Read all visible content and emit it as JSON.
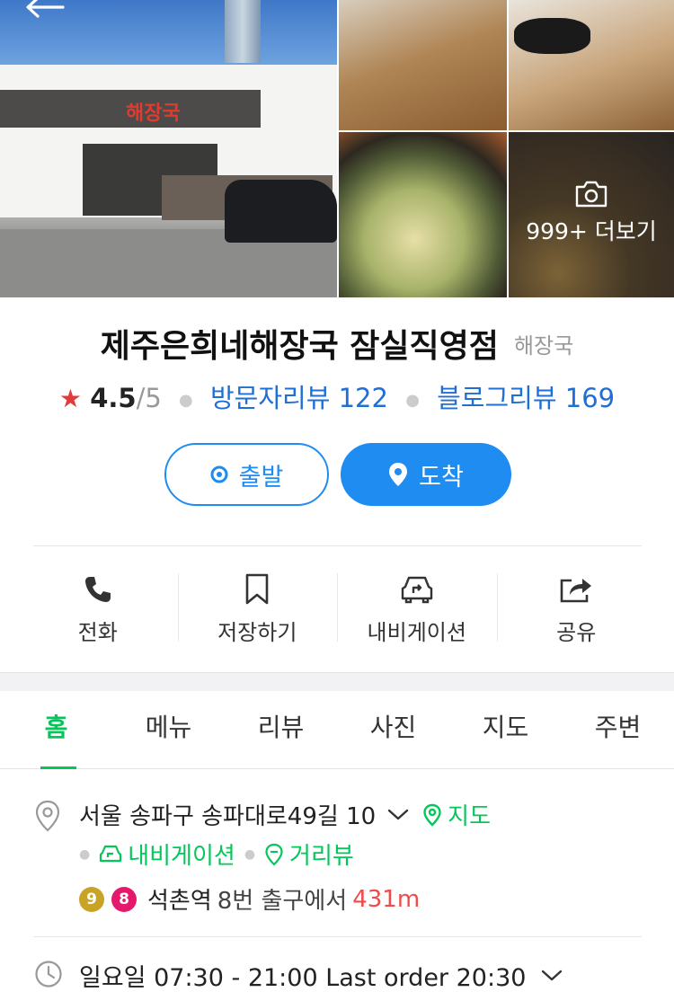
{
  "place": {
    "name": "제주은희네해장국 잠실직영점",
    "category": "해장국",
    "rating": "4.5",
    "rating_max": "/5",
    "visitor_reviews": "방문자리뷰 122",
    "blog_reviews": "블로그리뷰 169"
  },
  "photos": {
    "more_label": "999+ 더보기",
    "sign_text": "해장국"
  },
  "route": {
    "start_label": "출발",
    "arrive_label": "도착"
  },
  "actions": [
    {
      "label": "전화",
      "icon": "phone-icon"
    },
    {
      "label": "저장하기",
      "icon": "bookmark-icon"
    },
    {
      "label": "내비게이션",
      "icon": "car-navigation-icon"
    },
    {
      "label": "공유",
      "icon": "share-icon"
    }
  ],
  "tabs": [
    {
      "label": "홈",
      "active": true
    },
    {
      "label": "메뉴"
    },
    {
      "label": "리뷰"
    },
    {
      "label": "사진"
    },
    {
      "label": "지도"
    },
    {
      "label": "주변"
    }
  ],
  "info": {
    "address": "서울 송파구 송파대로49길 10",
    "map_link": "지도",
    "navigation_link": "내비게이션",
    "streetview_link": "거리뷰",
    "subway_line_1": "9",
    "subway_line_2": "8",
    "station": "석촌역",
    "exit_text": "8번 출구에서",
    "distance": "431m",
    "hours": "일요일 07:30 - 21:00 Last order 20:30"
  },
  "colors": {
    "accent_blue": "#1e8cf0",
    "naver_green": "#03c75a",
    "distance_red": "#f04b4b",
    "star_red": "#e23b3b",
    "line9_gold": "#c9a326",
    "line8_pink": "#e6186c"
  }
}
